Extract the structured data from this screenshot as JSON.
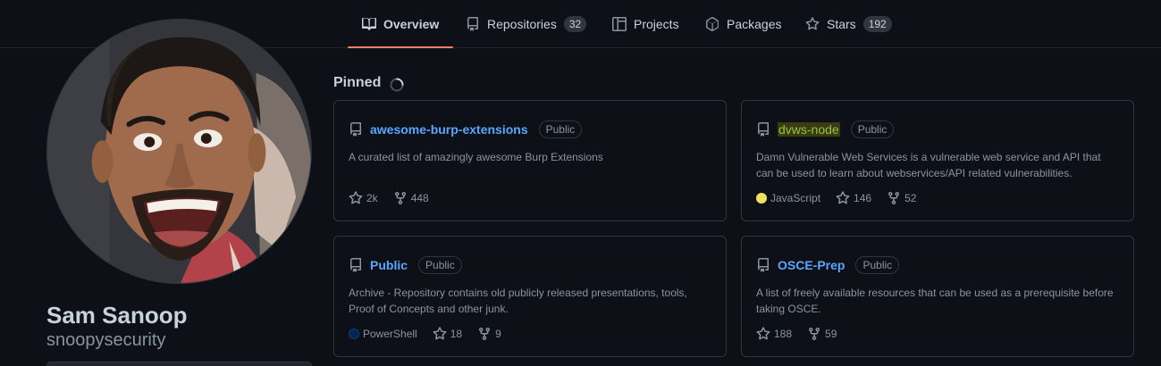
{
  "tabs": [
    {
      "label": "Overview",
      "icon": "book-icon",
      "counter": null
    },
    {
      "label": "Repositories",
      "icon": "repo-icon",
      "counter": "32"
    },
    {
      "label": "Projects",
      "icon": "project-icon",
      "counter": null
    },
    {
      "label": "Packages",
      "icon": "package-icon",
      "counter": null
    },
    {
      "label": "Stars",
      "icon": "star-icon",
      "counter": "192"
    }
  ],
  "profile": {
    "full_name": "Sam Sanoop",
    "username": "snoopysecurity"
  },
  "pinned": {
    "heading": "Pinned",
    "repos": [
      {
        "name": "awesome-burp-extensions",
        "visibility": "Public",
        "description": "A curated list of amazingly awesome Burp Extensions",
        "language": null,
        "language_color": null,
        "stars": "2k",
        "forks": "448"
      },
      {
        "name": "dvws-node",
        "visibility": "Public",
        "description": "Damn Vulnerable Web Services is a vulnerable web service and API that can be used to learn about webservices/API related vulnerabilities.",
        "language": "JavaScript",
        "language_color": "#f1e05a",
        "stars": "146",
        "forks": "52"
      },
      {
        "name": "Public",
        "visibility": "Public",
        "description": "Archive - Repository contains old publicly released presentations, tools, Proof of Concepts and other junk.",
        "language": "PowerShell",
        "language_color": "#012456",
        "stars": "18",
        "forks": "9"
      },
      {
        "name": "OSCE-Prep",
        "visibility": "Public",
        "description": "A list of freely available resources that can be used as a prerequisite before taking OSCE.",
        "language": null,
        "language_color": null,
        "stars": "188",
        "forks": "59"
      }
    ]
  },
  "colors": {
    "background": "#0d1117",
    "link": "#58a6ff",
    "tab_underline": "#f78166",
    "border": "#30363d"
  }
}
